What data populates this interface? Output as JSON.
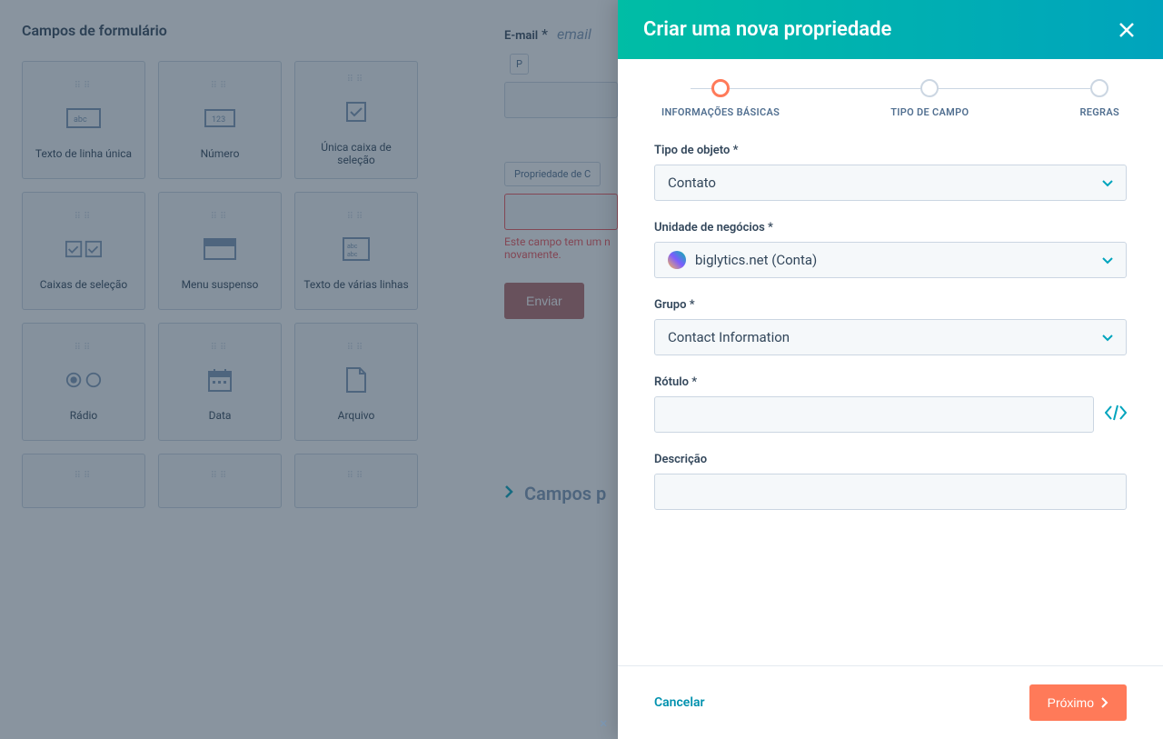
{
  "left": {
    "title": "Campos de formulário",
    "fields": [
      {
        "label": "Texto de linha única"
      },
      {
        "label": "Número"
      },
      {
        "label": "Única caixa de seleção"
      },
      {
        "label": "Caixas de seleção"
      },
      {
        "label": "Menu suspenso"
      },
      {
        "label": "Texto de várias linhas"
      },
      {
        "label": "Rádio"
      },
      {
        "label": "Data"
      },
      {
        "label": "Arquivo"
      }
    ]
  },
  "mid": {
    "email_label": "E-mail",
    "email_req": "*",
    "email_italic": "email",
    "email_badge_prefix": "P",
    "prop_badge": "Propriedade de C",
    "error_text": "Este campo tem um n\nnovamente.",
    "submit": "Enviar",
    "campos": "Campos p"
  },
  "drawer": {
    "title": "Criar uma nova propriedade",
    "steps": [
      "INFORMAÇÕES BÁSICAS",
      "TIPO DE CAMPO",
      "REGRAS"
    ],
    "object_type_label": "Tipo de objeto *",
    "object_type_value": "Contato",
    "bu_label": "Unidade de negócios *",
    "bu_value": "biglytics.net (Conta)",
    "group_label": "Grupo *",
    "group_value": "Contact Information",
    "rotulo_label": "Rótulo *",
    "rotulo_value": "",
    "desc_label": "Descrição",
    "desc_value": "",
    "cancel": "Cancelar",
    "next": "Próximo"
  }
}
